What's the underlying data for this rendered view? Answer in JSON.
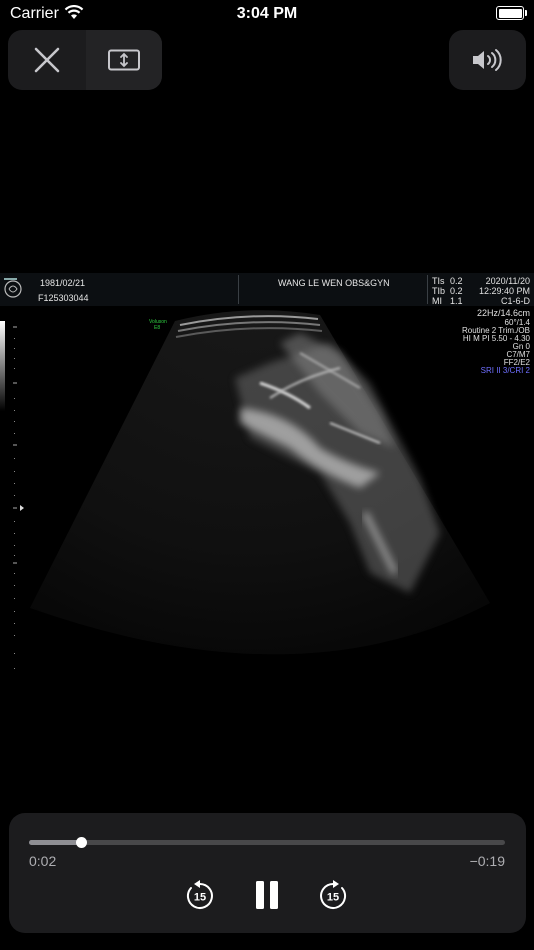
{
  "status_bar": {
    "carrier": "Carrier",
    "time": "3:04 PM",
    "battery_level": 1.0
  },
  "top_controls": {
    "close_icon": "close-icon",
    "resize_icon": "aspect-ratio-icon",
    "volume_icon": "speaker-volume-icon"
  },
  "ultrasound": {
    "date_of_birth": "1981/02/21",
    "patient_id": "F125303044",
    "patient_name": "WANG LE WEN OBS&GYN",
    "tis_label": "TIs",
    "tis_value": "0.2",
    "tib_label": "TIb",
    "tib_value": "0.2",
    "mi_label": "MI",
    "mi_value": "1.1",
    "exam_date": "2020/11/20",
    "exam_time": "12:29:40 PM",
    "probe": "C1-6-D",
    "params": [
      "22Hz/14.6cm",
      "60°/1.4",
      "Routine 2 Trim./OB",
      "HI M PI 5.50 - 4.30",
      "Gn   0",
      "C7/M7",
      "FF2/E2"
    ],
    "sri": "SRI II 3/CRI 2",
    "voluson_label": "Voluson",
    "voluson_sub": "E8"
  },
  "playback": {
    "elapsed": "0:02",
    "remaining": "−0:19",
    "progress": 0.11,
    "skip_back_label": "15",
    "skip_forward_label": "15",
    "icons": {
      "skip_back": "rewind-15-icon",
      "pause": "pause-icon",
      "skip_forward": "forward-15-icon"
    }
  }
}
